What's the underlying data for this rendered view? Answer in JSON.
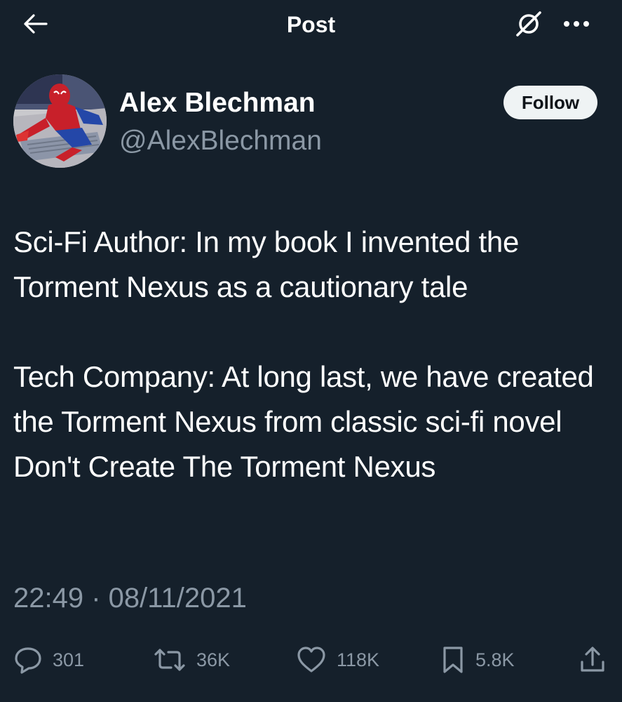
{
  "header": {
    "title": "Post",
    "back_icon": "arrow-left-icon",
    "grok_icon": "grok-icon",
    "more_icon": "more-horizontal-icon"
  },
  "author": {
    "name": "Alex Blechman",
    "handle": "@AlexBlechman",
    "avatar": "spider-man avatar photo"
  },
  "follow_label": "Follow",
  "post": {
    "text": "Sci-Fi Author: In my book I invented the Torment Nexus as a cautionary tale\n\nTech Company: At long last, we have created the Torment Nexus from classic sci-fi novel Don't Create The Torment Nexus",
    "timestamp": "22:49 · 08/11/2021"
  },
  "actions": {
    "replies": "301",
    "reposts": "36K",
    "likes": "118K",
    "bookmarks": "5.8K"
  },
  "colors": {
    "background": "#15202b",
    "text": "#ffffff",
    "secondary_text": "#8b98a5",
    "follow_button_bg": "#eff3f4"
  }
}
